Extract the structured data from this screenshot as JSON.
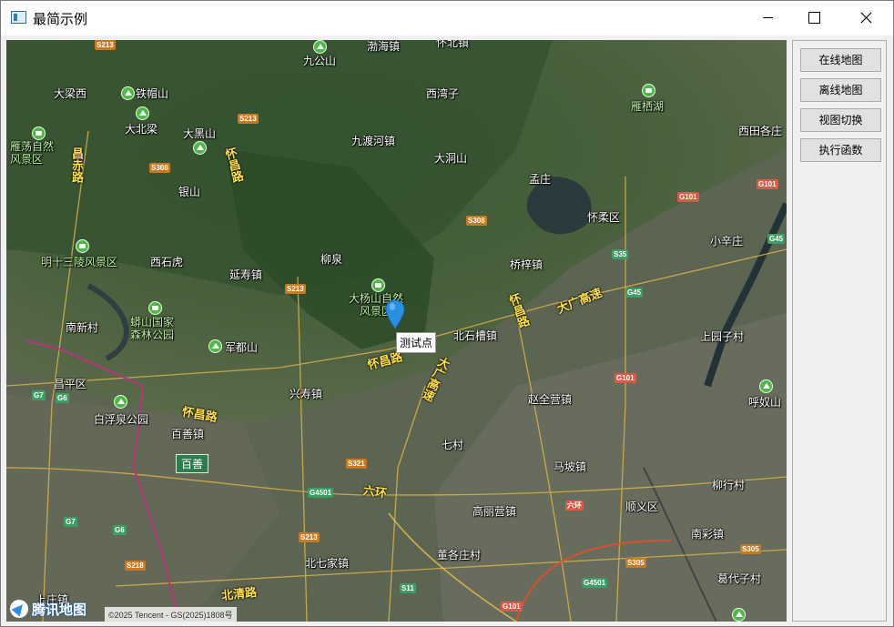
{
  "window": {
    "title": "最简示例",
    "controls": [
      "minimize-icon",
      "maximize-icon",
      "close-icon"
    ]
  },
  "map": {
    "marker_label": "测试点",
    "logo_text": "腾讯地图",
    "copyright": "©2025 Tencent - GS(2025)1808号",
    "place_labels": [
      "S213",
      "九公山",
      "渤海镇",
      "怀北镇",
      "雁栖湖",
      "大梁西",
      "铁帽山",
      "西湾子",
      "大北梁",
      "S213",
      "西田各庄",
      "雁荡自然风景区",
      "大黑山",
      "昌赤路",
      "九渡河镇",
      "大洞山",
      "S308",
      "银山",
      "孟庄",
      "怀柔区",
      "G101",
      "G101",
      "S308",
      "小辛庄",
      "G45",
      "明十三陵风景区",
      "西石虎",
      "柳泉",
      "S35",
      "桥梓镇",
      "延寿镇",
      "S213",
      "大杨山自然风景区",
      "G45",
      "南新村",
      "蟒山国家森林公园",
      "北石槽镇",
      "上园子村",
      "军都山",
      "昌平区",
      "G101",
      "兴寿镇",
      "赵全营镇",
      "G7",
      "G6",
      "白浮泉公园",
      "呼奴山",
      "百善镇",
      "七村",
      "百善",
      "S321",
      "马坡镇",
      "柳行村",
      "G4501",
      "六环",
      "高丽营镇",
      "顺义区",
      "G7",
      "G6",
      "南彩镇",
      "S213",
      "S305",
      "S305",
      "S218",
      "北七家镇",
      "董各庄村",
      "葛代子村",
      "G4501",
      "北清路",
      "S11",
      "上庄镇",
      "G101"
    ],
    "road_labels": [
      "昌赤路",
      "怀昌路",
      "怀昌路",
      "昌怀路",
      "大广高速",
      "大广高速",
      "六环",
      "北清路"
    ]
  },
  "panel": {
    "buttons": [
      "在线地图",
      "离线地图",
      "视图切换",
      "执行函数"
    ]
  },
  "colors": {
    "marker": "#2a8fe0",
    "window_bg": "#f0f0f0",
    "button_bg": "#e1e1e1"
  }
}
